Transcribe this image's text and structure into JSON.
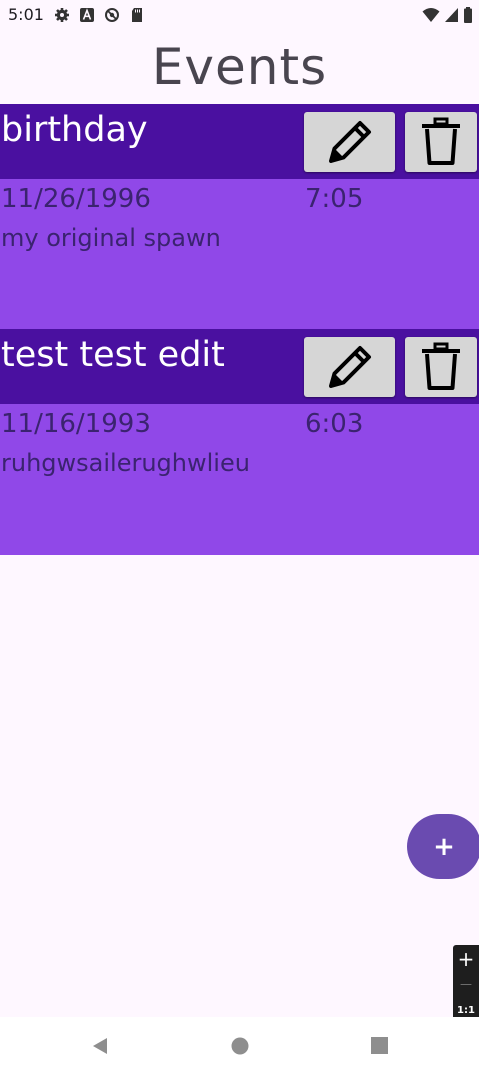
{
  "status_bar": {
    "time": "5:01",
    "left_icons": [
      "settings-icon",
      "a-icon",
      "circle-slash-icon",
      "sd-card-icon"
    ],
    "right_icons": [
      "wifi-icon",
      "signal-icon",
      "battery-icon"
    ]
  },
  "page": {
    "title": "Events"
  },
  "events": [
    {
      "name": "birthday",
      "date": "11/26/1996",
      "time": "7:05",
      "description": "my original spawn"
    },
    {
      "name": "test test edit",
      "date": "11/16/1993",
      "time": "6:03",
      "description": "ruhgwsailerughwlieu"
    }
  ],
  "fab": {
    "label": "+"
  },
  "zoom_control": {
    "plus": "+",
    "minus": "—",
    "ratio": "1:1"
  },
  "nav_bar": {
    "icons": [
      "back-icon",
      "home-icon",
      "recents-icon"
    ]
  },
  "colors": {
    "background": "#FEF7FF",
    "card_header": "#4A10A0",
    "card_body": "#9048E8",
    "card_text": "#3B2370",
    "button": "#D6D6D6",
    "fab": "#6A4BB0"
  }
}
